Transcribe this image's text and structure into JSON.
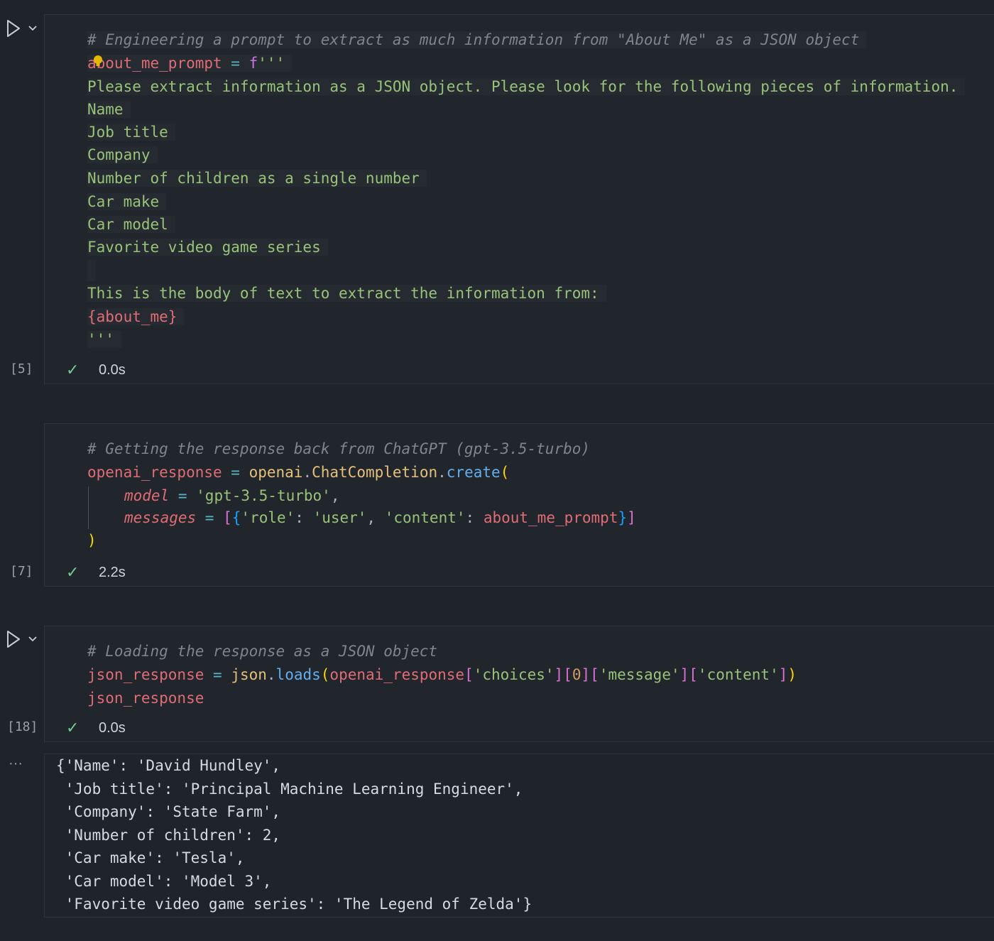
{
  "cells": [
    {
      "exec_count": "[5]",
      "timing": "0.0s",
      "lines": {
        "l1": "# Engineering a prompt to extract as much information from \"About Me\" as a JSON object",
        "l2_var": "about_me_prompt",
        "l2_op": " = ",
        "l2_kw": "f",
        "l2_str": "'''",
        "l3": "Please extract information as a JSON object. Please look for the following pieces of information.",
        "l4": "Name",
        "l5": "Job title",
        "l6": "Company",
        "l7": "Number of children as a single number",
        "l8": "Car make",
        "l9": "Car model",
        "l10": "Favorite video game series",
        "l12": "This is the body of text to extract the information from:",
        "l13": "{about_me}",
        "l14": "'''"
      }
    },
    {
      "exec_count": "[7]",
      "timing": "2.2s",
      "lines": {
        "l1": "# Getting the response back from ChatGPT (gpt-3.5-turbo)",
        "l2_var": "openai_response",
        "l2_op": " = ",
        "l2_mod": "openai",
        "l2_dot": ".",
        "l2_cls": "ChatCompletion",
        "l2_dot2": ".",
        "l2_fn": "create",
        "l2_paren": "(",
        "l3_param": "model",
        "l3_op": " = ",
        "l3_str": "'gpt-3.5-turbo'",
        "l3_comma": ",",
        "l4_param": "messages",
        "l4_op": " = ",
        "l4_b1": "[",
        "l4_b2": "{",
        "l4_k1": "'role'",
        "l4_c1": ": ",
        "l4_v1": "'user'",
        "l4_c2": ", ",
        "l4_k2": "'content'",
        "l4_c3": ": ",
        "l4_v2": "about_me_prompt",
        "l4_b3": "}",
        "l4_b4": "]",
        "l5": ")"
      }
    },
    {
      "exec_count": "[18]",
      "timing": "0.0s",
      "lines": {
        "l1": "# Loading the response as a JSON object",
        "l2_var": "json_response",
        "l2_op": " = ",
        "l2_mod": "json",
        "l2_dot": ".",
        "l2_fn": "loads",
        "l2_p1": "(",
        "l2_arg": "openai_response",
        "l2_b1": "[",
        "l2_s1": "'choices'",
        "l2_b2": "]",
        "l2_b3": "[",
        "l2_n": "0",
        "l2_b4": "]",
        "l2_b5": "[",
        "l2_s2": "'message'",
        "l2_b6": "]",
        "l2_b7": "[",
        "l2_s3": "'content'",
        "l2_b8": "]",
        "l2_p2": ")",
        "l3": "json_response"
      }
    }
  ],
  "output": {
    "ellipsis": "···",
    "lines": [
      "{'Name': 'David Hundley',",
      " 'Job title': 'Principal Machine Learning Engineer',",
      " 'Company': 'State Farm',",
      " 'Number of children': 2,",
      " 'Car make': 'Tesla',",
      " 'Car model': 'Model 3',",
      " 'Favorite video game series': 'The Legend of Zelda'}"
    ]
  },
  "status_icon": "check-icon",
  "colors": {
    "background": "#1f232b",
    "comment": "#7f848e",
    "variable": "#e06c75",
    "string": "#98c379",
    "function": "#61afef",
    "class": "#e5c07b",
    "success": "#73c991"
  }
}
